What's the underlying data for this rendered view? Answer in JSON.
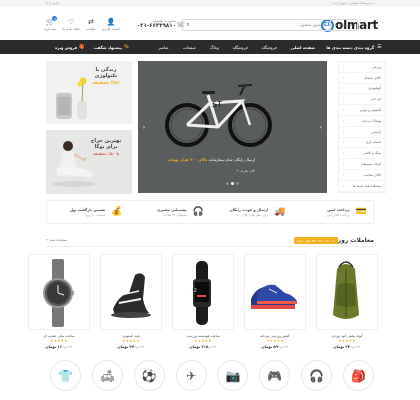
{
  "topstrip": {
    "left_text": "تماس با ما",
    "right_text": "به فروشگاه کولمارت خوش آمدید"
  },
  "header": {
    "logo_text": "olmart",
    "logo_mark": "CC",
    "search": {
      "category": "همه دسته ها",
      "placeholder": "جستجوی محصول ..."
    },
    "phone": {
      "label": "تماس با پشتیبانی",
      "number": "۰۲۱-۶۶۳۴۹۸۱۰"
    },
    "icons": [
      {
        "name": "cart-icon",
        "glyph": "🛒",
        "label": "سبد خرید",
        "badge": "0"
      },
      {
        "name": "wishlist-icon",
        "glyph": "♡",
        "label": "علاقه مندی ها"
      },
      {
        "name": "compare-icon",
        "glyph": "⇄",
        "label": "مقایسه"
      },
      {
        "name": "account-icon",
        "glyph": "👤",
        "label": "حساب کاربری"
      }
    ]
  },
  "navbar": {
    "category_button": "گروه بندی دسته بندی ها",
    "menu": [
      "صفحه اصلی",
      "فروشگاه",
      "فروشگاه",
      "وبلاگ",
      "صفحات",
      "عناصر"
    ],
    "right_buttons": [
      {
        "icon": "%",
        "label": "پیشنهاد شگفت"
      },
      {
        "icon": "🎁",
        "label": "فروش ویژه"
      }
    ]
  },
  "sidebar": {
    "items": [
      "ورزش",
      "کالای دیجیتال",
      "کوهنوردی",
      "لپ تاپ",
      "کامپیوتر و لوازم",
      "پوشاک مردانه",
      "آرایشی",
      "اسباب بازی",
      "سنگ و کاشی",
      "ادوات موسیقی",
      "کالای سلامت",
      "مشاهده همه دسته ها"
    ]
  },
  "slider": {
    "headline_pre": "ارسال رایگان تمام سفارشات",
    "headline_hl": "بالای ۲۰۰ هزار تومان",
    "sub": "الان بخرید ←",
    "dots": 3
  },
  "banners": [
    {
      "line1": "زندگی با",
      "line2": "تکنولوژی",
      "line3": "۲۵٪ تخفیف"
    },
    {
      "line1": "بهترین حراج",
      "line2": "برای یوگا",
      "line3": "تا ۵۰٪ تخفیف"
    }
  ],
  "features": [
    {
      "icon": "💳",
      "title": "پرداخت ایمن",
      "sub": "پرداخت آنلاین امن"
    },
    {
      "icon": "🚚",
      "title": "ارسال و عودت رایگان",
      "sub": "برای سفارشات بالای ۲۰۰"
    },
    {
      "icon": "🎧",
      "title": "پشتیبانی مشتری",
      "sub": "پشتیبانی ۲۴ ساعته"
    },
    {
      "icon": "💰",
      "title": "تضمین بازگشت پول",
      "sub": "ضمانت ۳۰ روزه"
    }
  ],
  "section": {
    "title": "معاملات روز",
    "timer": "۰۲ : ۱۸ : ۴۵ : ۳۴ باقی مانده",
    "more": "مشاهده همه ←"
  },
  "products": [
    {
      "name": "کوله پشتی کوه نوردی",
      "stars": "★★★★★",
      "price": "۳۴۰,۰۰۰ تومان"
    },
    {
      "name": "کفش ورزشی مردانه",
      "stars": "★★★★★",
      "price": "۵۹۰,۰۰۰ تومان"
    },
    {
      "name": "ساعت هوشمند ورزشی",
      "stars": "★★★★★",
      "price": "۲۱۸,۰۰۰ تومان"
    },
    {
      "name": "بایند اسنوبرد",
      "stars": "★★★★★",
      "price": "۴۷۰,۰۰۰ تومان"
    },
    {
      "name": "ساعت مچی عقربه ای",
      "stars": "★★★★★",
      "price": "۱۶۰,۰۰۰ تومان"
    }
  ],
  "categories": [
    {
      "name": "backpack-category-icon",
      "glyph": "🎒"
    },
    {
      "name": "headphones-category-icon",
      "glyph": "🎧"
    },
    {
      "name": "gamepad-category-icon",
      "glyph": "🎮"
    },
    {
      "name": "camera-category-icon",
      "glyph": "📷"
    },
    {
      "name": "plane-category-icon",
      "glyph": "✈"
    },
    {
      "name": "ball-category-icon",
      "glyph": "⚽"
    },
    {
      "name": "sofa-category-icon",
      "glyph": "🛋"
    },
    {
      "name": "tshirt-category-icon",
      "glyph": "👕"
    }
  ],
  "colors": {
    "accent": "#f2b01e",
    "brand": "#2a7fd0",
    "nav": "#2b2b2b"
  }
}
